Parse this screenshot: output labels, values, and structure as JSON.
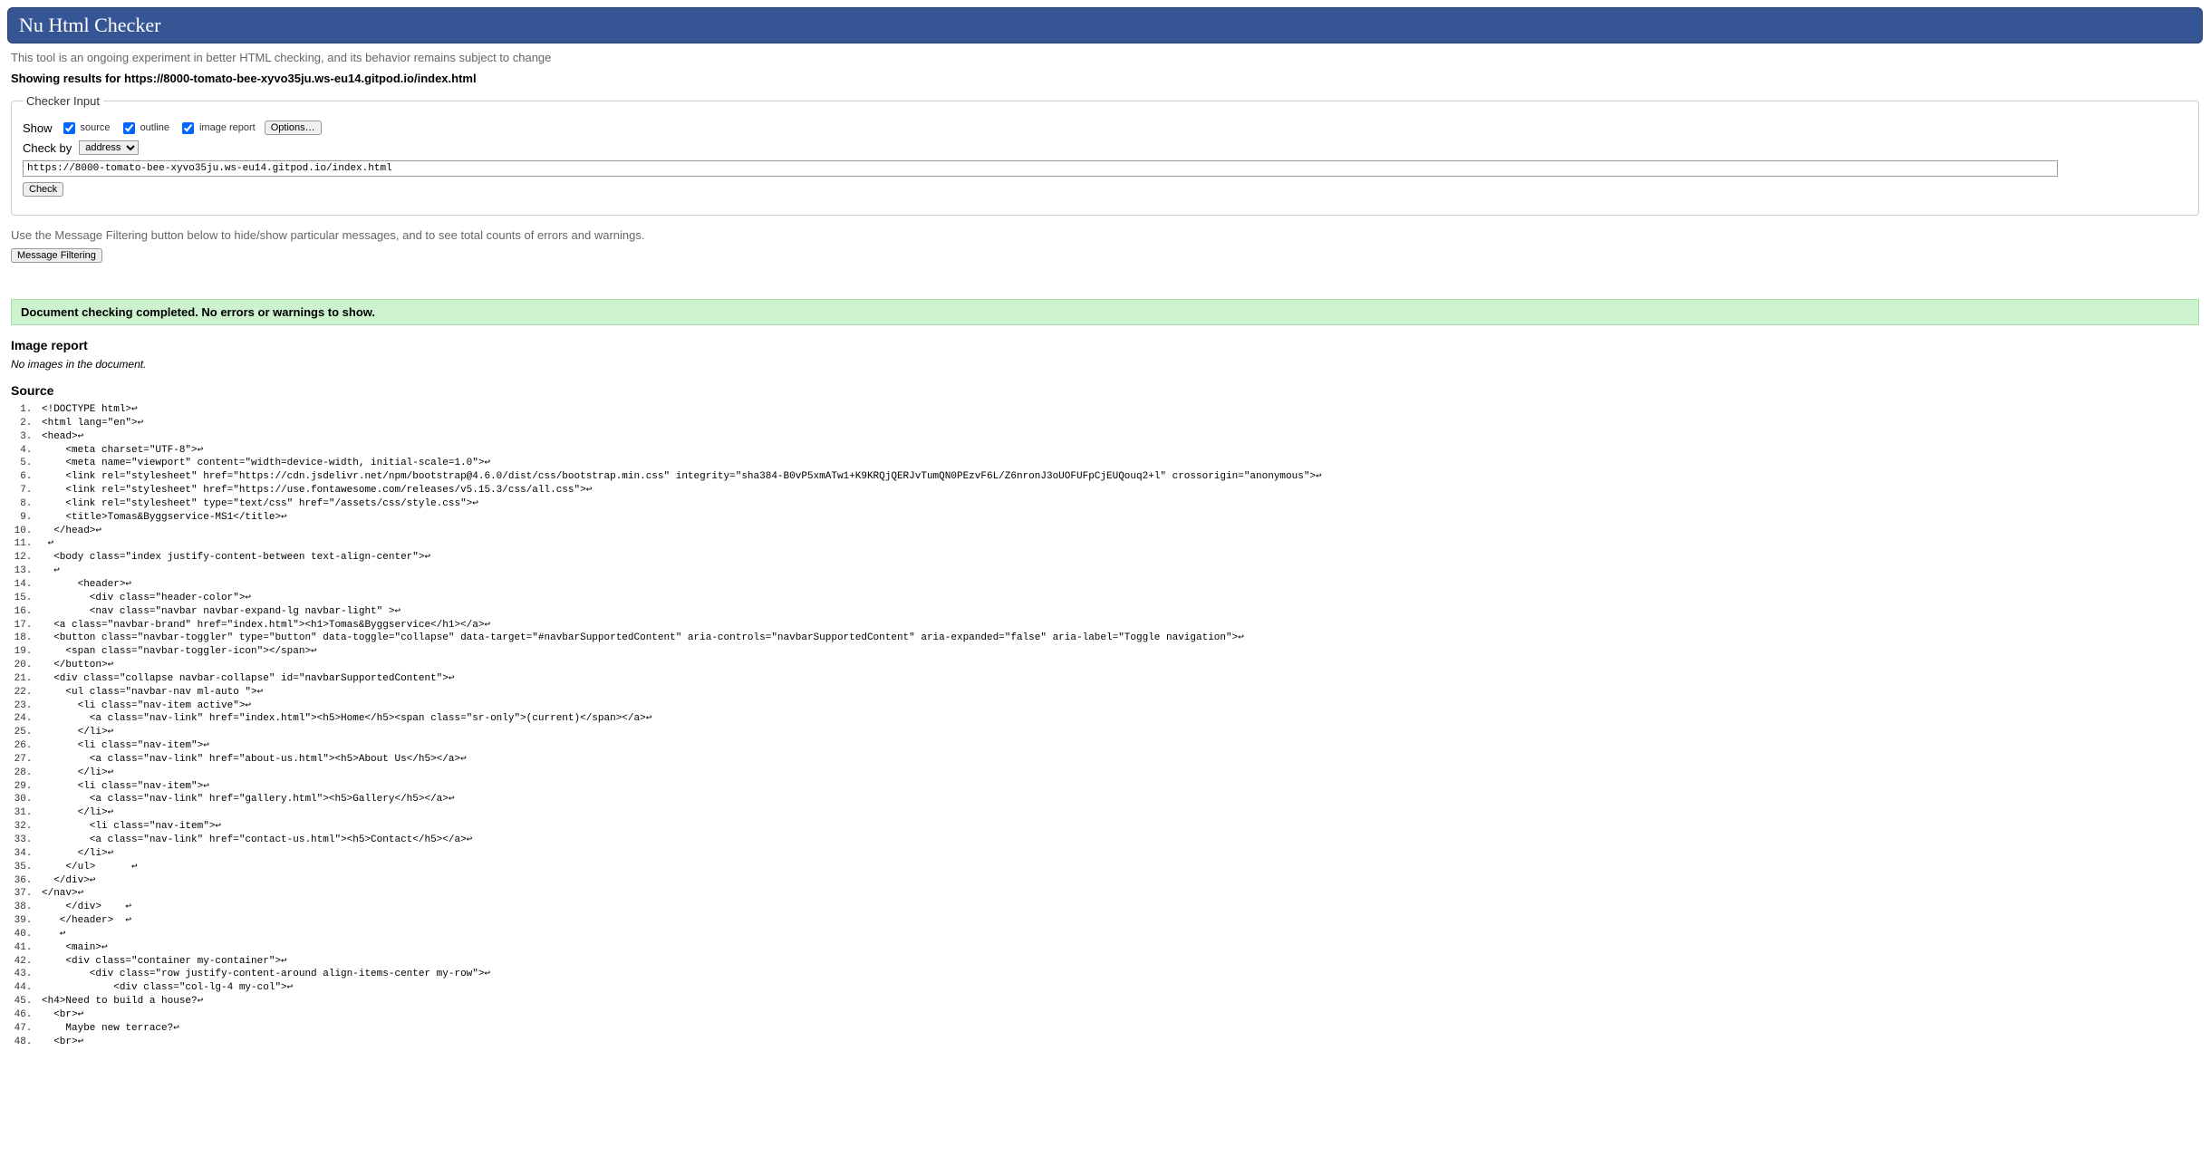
{
  "header": {
    "title": "Nu Html Checker"
  },
  "intro": "This tool is an ongoing experiment in better HTML checking, and its behavior remains subject to change",
  "results_prefix": "Showing results for ",
  "results_url": "https://8000-tomato-bee-xyvo35ju.ws-eu14.gitpod.io/index.html",
  "fieldset": {
    "legend": "Checker Input",
    "show_label": "Show",
    "cb_source": "source",
    "cb_outline": "outline",
    "cb_image": "image report",
    "options_btn": "Options…",
    "checkby_label": "Check by",
    "checkby_selected": "address",
    "url_value": "https://8000-tomato-bee-xyvo35ju.ws-eu14.gitpod.io/index.html",
    "check_btn": "Check"
  },
  "filter": {
    "desc": "Use the Message Filtering button below to hide/show particular messages, and to see total counts of errors and warnings.",
    "btn": "Message Filtering"
  },
  "success_msg": "Document checking completed. No errors or warnings to show.",
  "image_report": {
    "heading": "Image report",
    "note": "No images in the document."
  },
  "source_heading": "Source",
  "source_lines": [
    "<!DOCTYPE html>↩",
    "<html lang=\"en\">↩",
    "<head>↩",
    "    <meta charset=\"UTF-8\">↩",
    "    <meta name=\"viewport\" content=\"width=device-width, initial-scale=1.0\">↩",
    "    <link rel=\"stylesheet\" href=\"https://cdn.jsdelivr.net/npm/bootstrap@4.6.0/dist/css/bootstrap.min.css\" integrity=\"sha384-B0vP5xmATw1+K9KRQjQERJvTumQN0PEzvF6L/Z6nronJ3oUOFUFpCjEUQouq2+l\" crossorigin=\"anonymous\">↩",
    "    <link rel=\"stylesheet\" href=\"https://use.fontawesome.com/releases/v5.15.3/css/all.css\">↩",
    "    <link rel=\"stylesheet\" type=\"text/css\" href=\"/assets/css/style.css\">↩",
    "    <title>Tomas&Byggservice-MS1</title>↩",
    "  </head>↩",
    " ↩",
    "  <body class=\"index justify-content-between text-align-center\">↩",
    "  ↩",
    "      <header>↩",
    "        <div class=\"header-color\">↩",
    "        <nav class=\"navbar navbar-expand-lg navbar-light\" >↩",
    "  <a class=\"navbar-brand\" href=\"index.html\"><h1>Tomas&Byggservice</h1></a>↩",
    "  <button class=\"navbar-toggler\" type=\"button\" data-toggle=\"collapse\" data-target=\"#navbarSupportedContent\" aria-controls=\"navbarSupportedContent\" aria-expanded=\"false\" aria-label=\"Toggle navigation\">↩",
    "    <span class=\"navbar-toggler-icon\"></span>↩",
    "  </button>↩",
    "  <div class=\"collapse navbar-collapse\" id=\"navbarSupportedContent\">↩",
    "    <ul class=\"navbar-nav ml-auto \">↩",
    "      <li class=\"nav-item active\">↩",
    "        <a class=\"nav-link\" href=\"index.html\"><h5>Home</h5><span class=\"sr-only\">(current)</span></a>↩",
    "      </li>↩",
    "      <li class=\"nav-item\">↩",
    "        <a class=\"nav-link\" href=\"about-us.html\"><h5>About Us</h5></a>↩",
    "      </li>↩",
    "      <li class=\"nav-item\">↩",
    "        <a class=\"nav-link\" href=\"gallery.html\"><h5>Gallery</h5></a>↩",
    "      </li>↩",
    "        <li class=\"nav-item\">↩",
    "        <a class=\"nav-link\" href=\"contact-us.html\"><h5>Contact</h5></a>↩",
    "      </li>↩",
    "    </ul>      ↩",
    "  </div>↩",
    "</nav>↩",
    "    </div>    ↩",
    "   </header>  ↩",
    "   ↩",
    "    <main>↩",
    "    <div class=\"container my-container\">↩",
    "        <div class=\"row justify-content-around align-items-center my-row\">↩",
    "            <div class=\"col-lg-4 my-col\">↩",
    "<h4>Need to build a house?↩",
    "  <br>↩",
    "    Maybe new terrace?↩",
    "  <br>↩"
  ]
}
